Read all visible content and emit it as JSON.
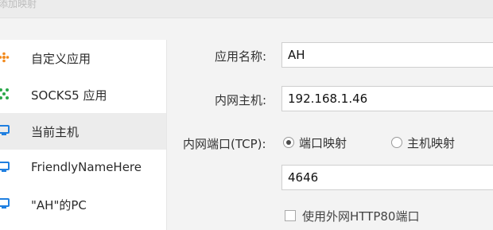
{
  "window": {
    "title": "添加映射"
  },
  "sidebar": {
    "items": [
      {
        "label": "自定义应用",
        "icon": "custom-app-icon",
        "selected": false
      },
      {
        "label": "SOCKS5 应用",
        "icon": "socks5-app-icon",
        "selected": false
      },
      {
        "label": "当前主机",
        "icon": "current-host-icon",
        "selected": true
      },
      {
        "label": "FriendlyNameHere",
        "icon": "host-icon",
        "selected": false
      },
      {
        "label": "\"AH\"的PC",
        "icon": "host-icon",
        "selected": false
      }
    ]
  },
  "form": {
    "app_name_label": "应用名称:",
    "app_name_value": "AH",
    "lan_host_label": "内网主机:",
    "lan_host_value": "192.168.1.46",
    "lan_port_label": "内网端口(TCP):",
    "radio_port_mapping": {
      "label": "端口映射",
      "checked": true
    },
    "radio_host_mapping": {
      "label": "主机映射",
      "checked": false
    },
    "lan_port_value": "4646",
    "use_http80_checkbox": {
      "label": "使用外网HTTP80端口",
      "checked": false
    }
  },
  "colors": {
    "accent_blue": "#1f7fe0",
    "accent_orange": "#f28a1e",
    "accent_green": "#2aa84a",
    "selected_bg": "#ececec"
  }
}
